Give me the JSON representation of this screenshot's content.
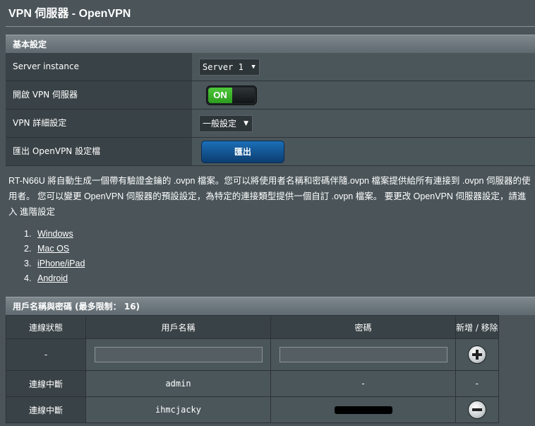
{
  "page": {
    "title": "VPN 伺服器 - OpenVPN"
  },
  "basic": {
    "header": "基本設定",
    "rows": {
      "server_instance": {
        "label": "Server instance",
        "value": "Server 1"
      },
      "enable_vpn": {
        "label": "開啟 VPN 伺服器",
        "state": "ON"
      },
      "vpn_detail": {
        "label": "VPN 詳細設定",
        "value": "一般設定"
      },
      "export": {
        "label": "匯出 OpenVPN 設定檔",
        "button": "匯出"
      }
    }
  },
  "description": "RT-N66U 將自動生成一個帶有驗證金鑰的 .ovpn 檔案。您可以將使用者名稱和密碼伴隨.ovpn 檔案提供給所有連接到 .ovpn 伺服器的使用者。 您可以變更 OpenVPN 伺服器的預設設定，為特定的連接類型提供一個自訂 .ovpn 檔案。 要更改 OpenVPN 伺服器設定，請進入 進階設定",
  "os_list": [
    {
      "num": "1.",
      "label": "Windows"
    },
    {
      "num": "2.",
      "label": "Mac OS"
    },
    {
      "num": "3.",
      "label": "iPhone/iPad"
    },
    {
      "num": "4.",
      "label": "Android"
    }
  ],
  "users": {
    "header": "用戶名稱與密碼 (最多限制： 16)",
    "columns": [
      "連線狀態",
      "用戶名稱",
      "密碼",
      "新增 / 移除"
    ],
    "new_row": {
      "status": "-"
    },
    "rows": [
      {
        "status": "連線中斷",
        "username": "admin",
        "password": "-",
        "action": "-"
      },
      {
        "status": "連線中斷",
        "username": "ihmcjacky",
        "password": "",
        "action": "remove"
      }
    ]
  },
  "icons": {
    "add": "add-circle-icon",
    "remove": "remove-circle-icon",
    "dropdown": "dropdown-arrow-icon"
  },
  "colors": {
    "toggle_on": "#2c9d1f",
    "export_button": "#1b6fb7"
  }
}
